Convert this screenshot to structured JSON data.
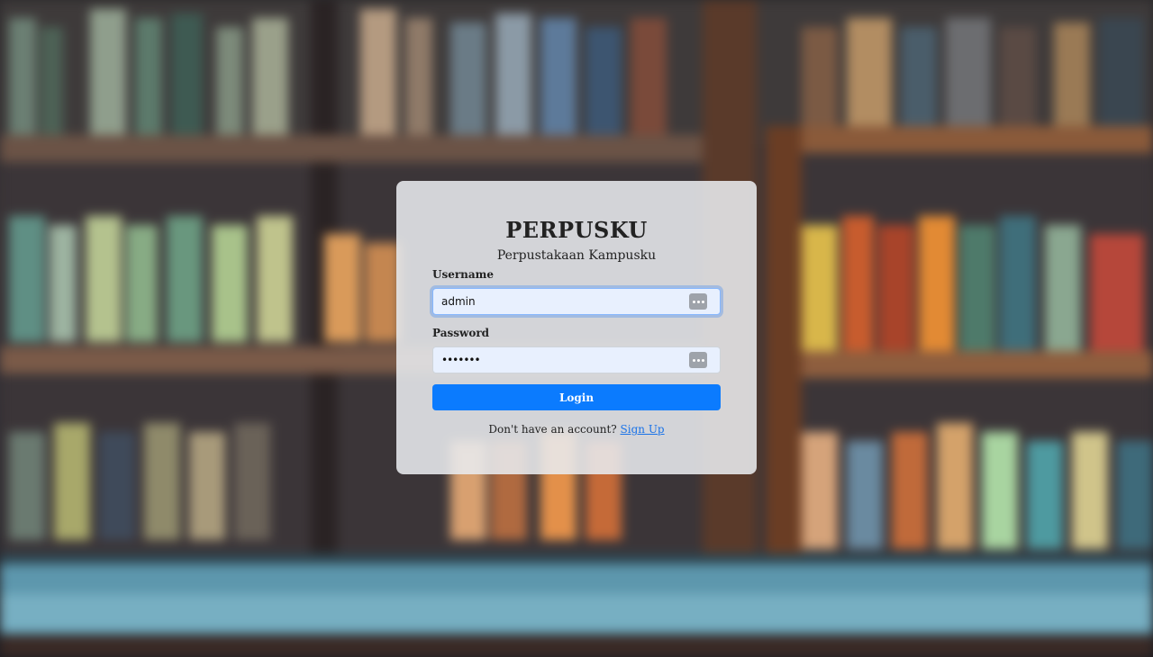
{
  "app": {
    "title": "PERPUSKU",
    "subtitle": "Perpustakaan Kampusku"
  },
  "form": {
    "username_label": "Username",
    "username_value": "admin",
    "password_label": "Password",
    "password_masked": "•••••••",
    "login_label": "Login",
    "no_account_text": "Don't have an account?",
    "signup_label": "Sign Up"
  },
  "icons": {
    "username_field_icon": "password-manager-icon",
    "password_field_icon": "password-manager-icon"
  },
  "colors": {
    "primary": "#0b7bfe",
    "link": "#1a73e8",
    "field_bg": "#e8f0fe"
  }
}
